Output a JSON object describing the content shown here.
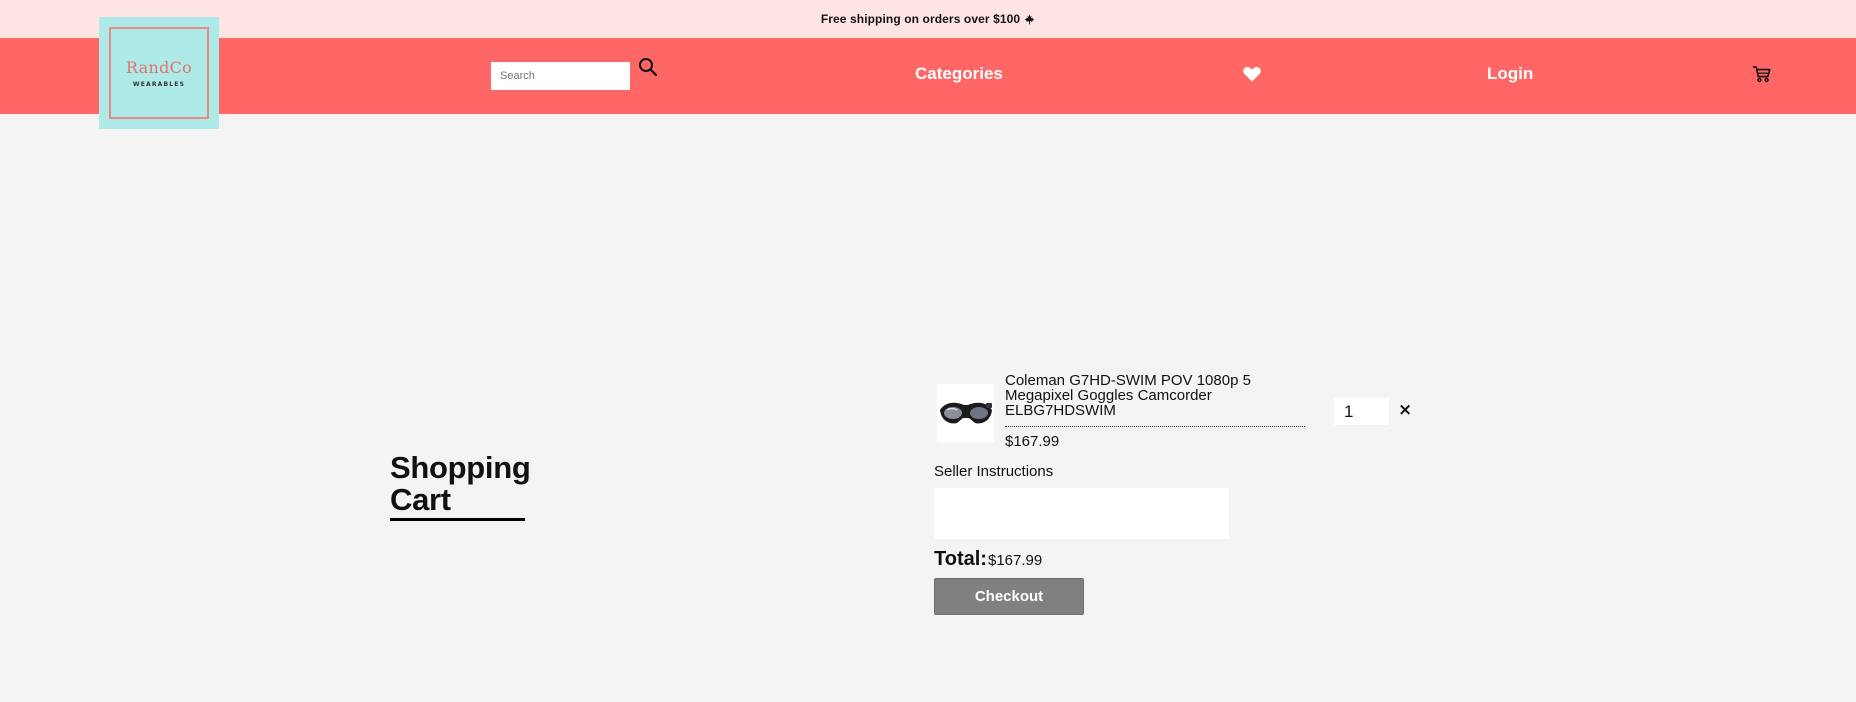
{
  "promo": {
    "text": "Free shipping on orders over $100",
    "icon": "maple-leaf-icon"
  },
  "logo": {
    "brand": "RandCo",
    "sub": "WEARABLES",
    "colors": {
      "background": "#aeeae8",
      "accent": "#e0756f"
    }
  },
  "header": {
    "background": "#ff6666",
    "search": {
      "placeholder": "Search",
      "value": "",
      "icon": "search-icon"
    },
    "nav": {
      "categories": "Categories",
      "wishlist_icon": "heart-icon",
      "login": "Login",
      "cart_icon": "shopping-cart-icon"
    }
  },
  "page": {
    "title_line1": "Shopping",
    "title_line2": "Cart"
  },
  "cart": {
    "items": [
      {
        "name_lines": [
          "Coleman G7HD-SWIM POV 1080p 5",
          "Megapixel Goggles Camcorder",
          "ELBG7HDSWIM"
        ],
        "price": "$167.99",
        "quantity": "1",
        "remove_symbol": "×",
        "thumbnail_icon": "goggles-camcorder-image"
      }
    ],
    "instructions_label": "Seller Instructions",
    "instructions_value": "",
    "total_label": "Total:",
    "total_value": "$167.99",
    "checkout_label": "Checkout"
  }
}
